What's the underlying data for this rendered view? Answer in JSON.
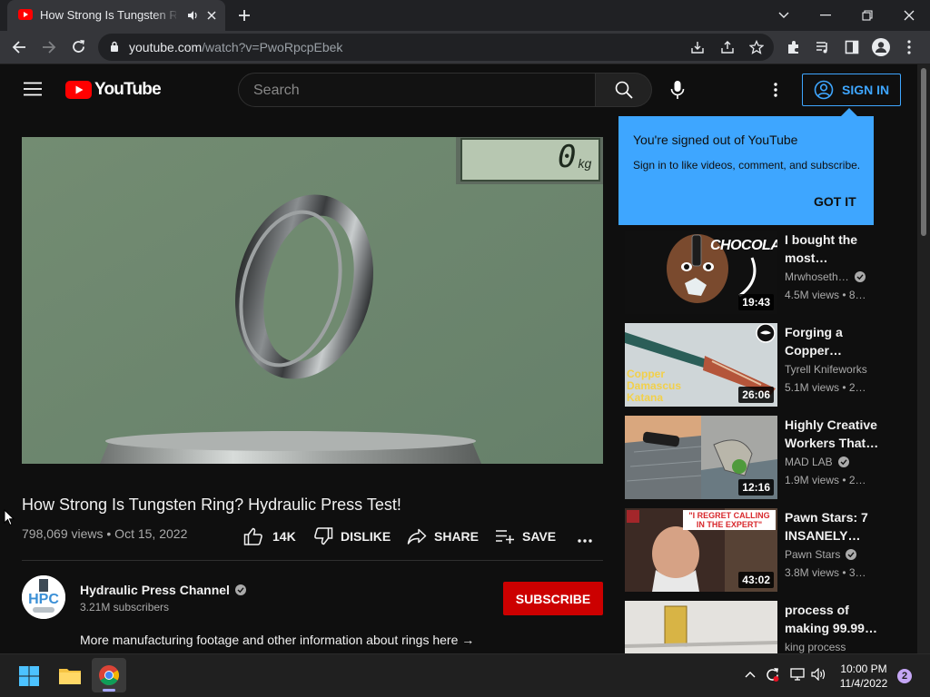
{
  "browser": {
    "tab_title": "How Strong Is Tungsten Ring",
    "url_host": "youtube.com",
    "url_path": "/watch?v=PwoRpcpEbek"
  },
  "masthead": {
    "logo_text": "YouTube",
    "search_placeholder": "Search",
    "sign_in_label": "SIGN IN"
  },
  "popup": {
    "title": "You're signed out of YouTube",
    "body": "Sign in to like videos, comment, and subscribe.",
    "button": "GOT IT"
  },
  "player": {
    "scale_readout": "0",
    "scale_unit": "kg"
  },
  "video": {
    "title": "How Strong Is Tungsten Ring? Hydraulic Press Test!",
    "meta": "798,069 views • Oct 15, 2022",
    "actions": {
      "like_count": "14K",
      "dislike_label": "DISLIKE",
      "share_label": "SHARE",
      "save_label": "SAVE"
    }
  },
  "channel": {
    "avatar_text": "HPC",
    "name": "Hydraulic Press Channel",
    "subscribers": "3.21M subscribers",
    "subscribe_label": "SUBSCRIBE",
    "description": "More manufacturing footage and other information about rings here →"
  },
  "recommendations": [
    {
      "title": "I bought the most…",
      "channel": "Mrwhoseth…",
      "verified": true,
      "meta": "4.5M views • 8…",
      "duration": "19:43",
      "thumb_text": "CHOCOLATE"
    },
    {
      "title": "Forging a Copper…",
      "channel": "Tyrell Knifeworks",
      "verified": false,
      "meta": "5.1M views • 2…",
      "duration": "26:06",
      "thumb_text": "Copper Damascus Katana"
    },
    {
      "title": "Highly Creative Workers That…",
      "channel": "MAD LAB",
      "verified": true,
      "meta": "1.9M views • 2…",
      "duration": "12:16",
      "thumb_text": ""
    },
    {
      "title": "Pawn Stars: 7 INSANELY…",
      "channel": "Pawn Stars",
      "verified": true,
      "meta": "3.8M views • 3…",
      "duration": "43:02",
      "thumb_text": "\"I REGRET CALLING IN THE EXPERT\""
    },
    {
      "title": "process of making 99.99…",
      "channel": "king process",
      "verified": false,
      "meta": "",
      "duration": "",
      "thumb_text": ""
    }
  ],
  "taskbar": {
    "time": "10:00 PM",
    "date": "11/4/2022",
    "notification_count": "2"
  },
  "colors": {
    "youtube_red": "#ff0000",
    "accent_blue": "#3ea6ff",
    "subscribe_red": "#cc0000"
  }
}
